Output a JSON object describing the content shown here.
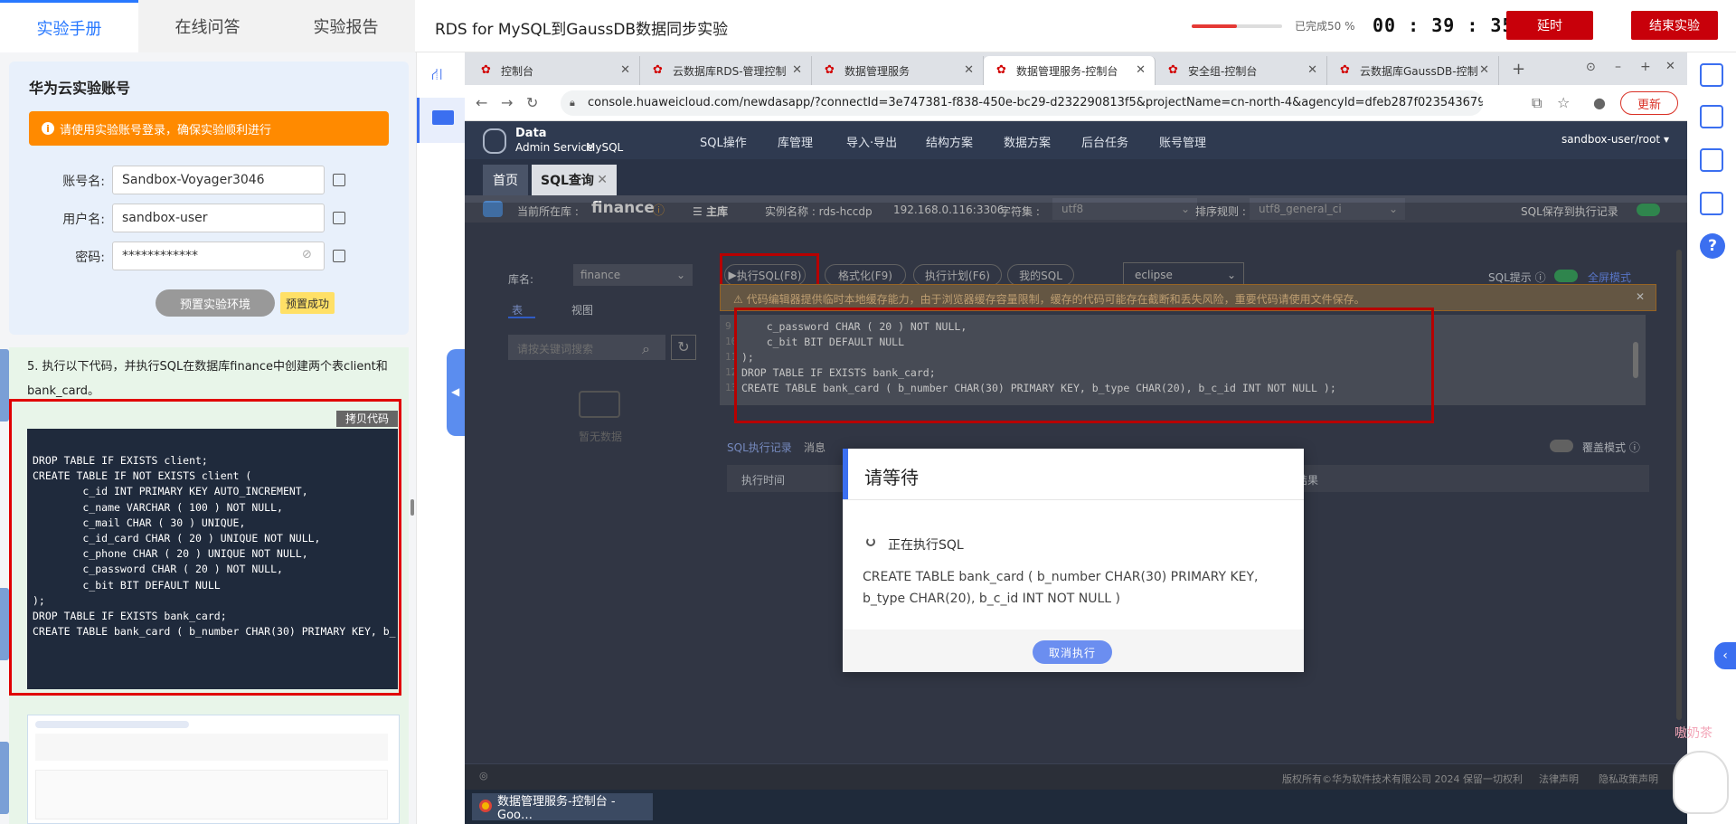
{
  "left_tabs": [
    "实验手册",
    "在线问答",
    "实验报告"
  ],
  "experiment_title": "RDS for MySQL到GaussDB数据同步实验",
  "progress": {
    "percent": 50,
    "label": "已完成50 %"
  },
  "timer": "00 : 39 : 35",
  "buttons": {
    "extend": "延时",
    "end": "结束实验"
  },
  "account": {
    "title": "华为云实验账号",
    "warning": "请使用实验账号登录，确保实验顺利进行",
    "fields": [
      {
        "label": "账号名:",
        "value": "Sandbox-Voyager3046"
      },
      {
        "label": "用户名:",
        "value": "sandbox-user"
      },
      {
        "label": "密码:",
        "value": "************"
      }
    ],
    "preset_button": "预置实验环境",
    "preset_status": "预置成功"
  },
  "step": {
    "text": "5. 执行以下代码，并执行SQL在数据库finance中创建两个表client和bank_card。",
    "copy_button": "拷贝代码",
    "code_lines": [
      "DROP TABLE IF EXISTS client;",
      "CREATE TABLE IF NOT EXISTS client (",
      "        c_id INT PRIMARY KEY AUTO_INCREMENT,",
      "        c_name VARCHAR ( 100 ) NOT NULL,",
      "        c_mail CHAR ( 30 ) UNIQUE,",
      "        c_id_card CHAR ( 20 ) UNIQUE NOT NULL,",
      "        c_phone CHAR ( 20 ) UNIQUE NOT NULL,",
      "        c_password CHAR ( 20 ) NOT NULL,",
      "        c_bit BIT DEFAULT NULL",
      ");",
      "DROP TABLE IF EXISTS bank_card;",
      "CREATE TABLE bank_card ( b_number CHAR(30) PRIMARY KEY, b_"
    ]
  },
  "browser": {
    "tabs": [
      "控制台",
      "云数据库RDS-管理控制",
      "数据管理服务",
      "数据管理服务-控制台",
      "安全组-控制台",
      "云数据库GaussDB-控制"
    ],
    "active_tab": 3,
    "url": "console.huaweicloud.com/newdasapp/?connectId=3e747381-f838-450e-bc29-d232290813f5&projectName=cn-north-4&agencyId=dfeb287f023543679e18625994f7…",
    "update_button": "更新"
  },
  "das": {
    "logo_line1": "Data",
    "logo_line2": "Admin Service",
    "logo_line3": "MySQL",
    "menus": [
      "SQL操作",
      "库管理",
      "导入·导出",
      "结构方案",
      "数据方案",
      "后台任务",
      "账号管理"
    ],
    "user": "sandbox-user/root",
    "tabs": [
      "首页",
      "SQL查询"
    ],
    "current_db_label": "当前所在库 :",
    "current_db": "finance",
    "master": "主库",
    "instance": "实例名称 : rds-hccdp",
    "ip": "192.168.0.116:3306",
    "charset_label": "字符集 :",
    "charset": "utf8",
    "collation_label": "排序规则 :",
    "collation": "utf8_general_ci",
    "sql_save": "SQL保存到执行记录",
    "db_label": "库名:",
    "db_value": "finance",
    "side_tabs": [
      "表",
      "视图"
    ],
    "search_placeholder": "请按关键词搜索",
    "no_data": "暂无数据",
    "toolbar": [
      "执行SQL(F8)",
      "格式化(F9)",
      "执行计划(F6)",
      "我的SQL"
    ],
    "theme": "eclipse",
    "sql_hint": "SQL提示",
    "fullscreen": "全屏模式",
    "banner": "代码编辑器提供临时本地缓存能力，由于浏览器缓存容量限制，缓存的代码可能存在截断和丢失风险，重要代码请使用文件保存。",
    "editor_lines": [
      {
        "no": "9",
        "text": "    c_password CHAR ( 20 ) NOT NULL,"
      },
      {
        "no": "10",
        "text": "    c_bit BIT DEFAULT NULL"
      },
      {
        "no": "11",
        "text": ");"
      },
      {
        "no": "12",
        "text": "DROP TABLE IF EXISTS bank_card;"
      },
      {
        "no": "13",
        "text": "CREATE TABLE bank_card ( b_number CHAR(30) PRIMARY KEY, b_type CHAR(20), b_c_id INT NOT NULL );"
      }
    ],
    "result_tabs": [
      "SQL执行记录",
      "消息"
    ],
    "overwrite_mode": "覆盖模式",
    "columns": [
      "执行时间",
      "结果"
    ],
    "footer": "版权所有©华为软件技术有限公司 2024 保留一切权利",
    "footer_links": [
      "法律声明",
      "隐私政策声明"
    ]
  },
  "modal": {
    "title": "请等待",
    "status": "正在执行SQL",
    "sql": "CREATE TABLE bank_card ( b_number CHAR(30) PRIMARY KEY, b_type CHAR(20), b_c_id INT NOT NULL )",
    "cancel": "取消执行"
  },
  "taskbar_item": "数据管理服务-控制台 - Goo…",
  "watermark": "嗷奶茶"
}
